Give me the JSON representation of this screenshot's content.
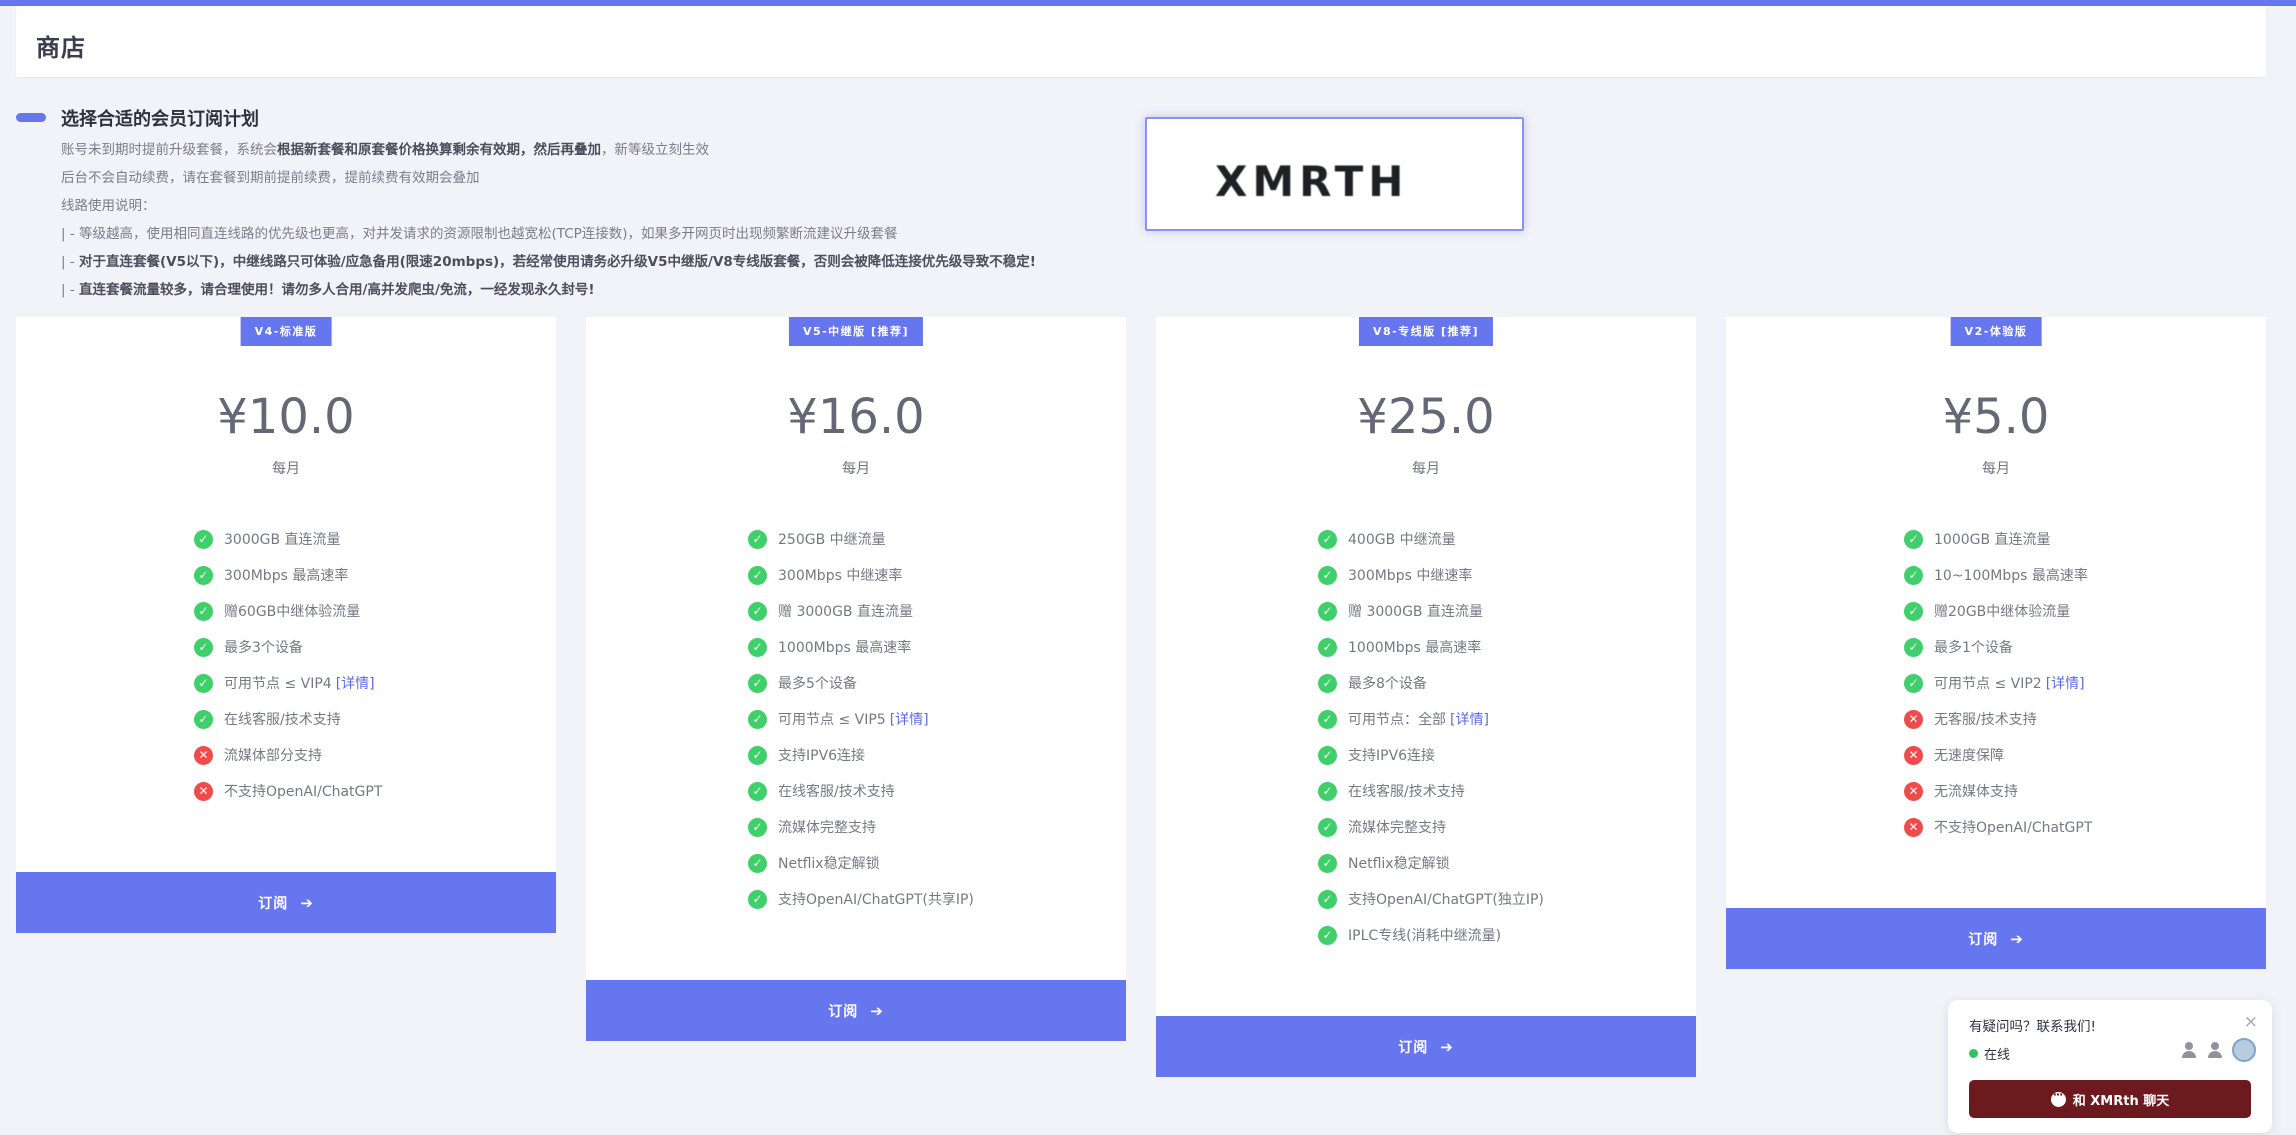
{
  "header": {
    "title": "商店"
  },
  "intro": {
    "heading": "选择合适的会员订阅计划",
    "line1_a": "账号未到期时提前升级套餐，系统会",
    "line1_b": "根据新套餐和原套餐价格换算剩余有效期，然后再叠加",
    "line1_c": "，新等级立刻生效",
    "line2": "后台不会自动续费，请在套餐到期前提前续费，提前续费有效期会叠加",
    "line3": "线路使用说明：",
    "line4": "| - 等级越高，使用相同直连线路的优先级也更高，对并发请求的资源限制也越宽松(TCP连接数)，如果多开网页时出现频繁断流建议升级套餐",
    "line5_a": "| - ",
    "line5_b": "对于直连套餐(V5以下)，中继线路只可体验/应急备用(限速20mbps)，若经常使用请务必升级V5中继版/V8专线版套餐，否则会被降低连接优先级导致不稳定!",
    "line6_a": "| - ",
    "line6_b": "直连套餐流量较多，请合理使用！请勿多人合用/高并发爬虫/免流，一经发现永久封号!"
  },
  "logo": {
    "text": "XMRTH"
  },
  "plans": [
    {
      "badge": "V4-标准版",
      "price": "¥10.0",
      "period": "每月",
      "features": [
        {
          "ok": true,
          "text": "3000GB 直连流量"
        },
        {
          "ok": true,
          "text": "300Mbps 最高速率"
        },
        {
          "ok": true,
          "text": "赠60GB中继体验流量"
        },
        {
          "ok": true,
          "text": "最多3个设备"
        },
        {
          "ok": true,
          "text": "可用节点 ≤ VIP4",
          "link": "[详情]"
        },
        {
          "ok": true,
          "text": "在线客服/技术支持"
        },
        {
          "ok": false,
          "text": "流媒体部分支持"
        },
        {
          "ok": false,
          "text": "不支持OpenAI/ChatGPT"
        }
      ],
      "cta": "订阅"
    },
    {
      "badge": "V5-中继版 [推荐]",
      "price": "¥16.0",
      "period": "每月",
      "features": [
        {
          "ok": true,
          "text": "250GB 中继流量"
        },
        {
          "ok": true,
          "text": "300Mbps 中继速率"
        },
        {
          "ok": true,
          "text": "赠 3000GB 直连流量"
        },
        {
          "ok": true,
          "text": "1000Mbps 最高速率"
        },
        {
          "ok": true,
          "text": "最多5个设备"
        },
        {
          "ok": true,
          "text": "可用节点 ≤ VIP5",
          "link": "[详情]"
        },
        {
          "ok": true,
          "text": "支持IPV6连接"
        },
        {
          "ok": true,
          "text": "在线客服/技术支持"
        },
        {
          "ok": true,
          "text": "流媒体完整支持"
        },
        {
          "ok": true,
          "text": "Netflix稳定解锁"
        },
        {
          "ok": true,
          "text": "支持OpenAI/ChatGPT(共享IP)"
        }
      ],
      "cta": "订阅"
    },
    {
      "badge": "V8-专线版 [推荐]",
      "price": "¥25.0",
      "period": "每月",
      "features": [
        {
          "ok": true,
          "text": "400GB 中继流量"
        },
        {
          "ok": true,
          "text": "300Mbps 中继速率"
        },
        {
          "ok": true,
          "text": "赠 3000GB 直连流量"
        },
        {
          "ok": true,
          "text": "1000Mbps 最高速率"
        },
        {
          "ok": true,
          "text": "最多8个设备"
        },
        {
          "ok": true,
          "text": "可用节点：全部",
          "link": "[详情]"
        },
        {
          "ok": true,
          "text": "支持IPV6连接"
        },
        {
          "ok": true,
          "text": "在线客服/技术支持"
        },
        {
          "ok": true,
          "text": "流媒体完整支持"
        },
        {
          "ok": true,
          "text": "Netflix稳定解锁"
        },
        {
          "ok": true,
          "text": "支持OpenAI/ChatGPT(独立IP)"
        },
        {
          "ok": true,
          "text": "IPLC专线(消耗中继流量)"
        }
      ],
      "cta": "订阅"
    },
    {
      "badge": "V2-体验版",
      "price": "¥5.0",
      "period": "每月",
      "features": [
        {
          "ok": true,
          "text": "1000GB 直连流量"
        },
        {
          "ok": true,
          "text": "10~100Mbps 最高速率"
        },
        {
          "ok": true,
          "text": "赠20GB中继体验流量"
        },
        {
          "ok": true,
          "text": "最多1个设备"
        },
        {
          "ok": true,
          "text": "可用节点 ≤ VIP2",
          "link": "[详情]"
        },
        {
          "ok": false,
          "text": "无客服/技术支持"
        },
        {
          "ok": false,
          "text": "无速度保障"
        },
        {
          "ok": false,
          "text": "无流媒体支持"
        },
        {
          "ok": false,
          "text": "不支持OpenAI/ChatGPT"
        }
      ],
      "cta": "订阅"
    }
  ],
  "chat": {
    "question": "有疑问吗？联系我们!",
    "close": "×",
    "status": "在线",
    "button": "和 XMRth 聊天"
  },
  "icons": {
    "ok": "check-circle-icon",
    "no": "x-circle-icon",
    "arrow": "arrow-right-icon"
  },
  "colors": {
    "accent": "#6576ee",
    "ok": "#3fcf6b",
    "no": "#f04b4b",
    "chat_button": "#6d1a1f"
  }
}
